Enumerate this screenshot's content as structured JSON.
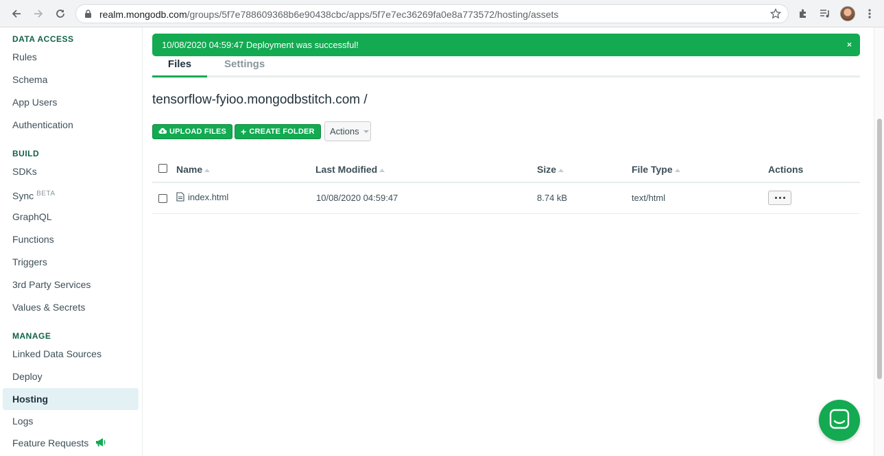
{
  "browser": {
    "url_host": "realm.mongodb.com",
    "url_path": "/groups/5f7e788609368b6e90438cbc/apps/5f7e7ec36269fa0e8a773572/hosting/assets"
  },
  "sidebar": {
    "sections": [
      {
        "title": "DATA ACCESS",
        "items": [
          "Rules",
          "Schema",
          "App Users",
          "Authentication"
        ]
      },
      {
        "title": "BUILD",
        "items": [
          "SDKs",
          "Sync",
          "GraphQL",
          "Functions",
          "Triggers",
          "3rd Party Services",
          "Values & Secrets"
        ]
      },
      {
        "title": "MANAGE",
        "items": [
          "Linked Data Sources",
          "Deploy",
          "Hosting",
          "Logs",
          "Feature Requests"
        ]
      }
    ],
    "sync_badge": "BETA",
    "active_item": "Hosting"
  },
  "alert": {
    "message": "10/08/2020 04:59:47 Deployment was successful!",
    "close": "×"
  },
  "tabs": [
    {
      "label": "Files",
      "active": true
    },
    {
      "label": "Settings",
      "active": false
    }
  ],
  "path_heading": "tensorflow-fyioo.mongodbstitch.com /",
  "toolbar": {
    "upload_label": "UPLOAD FILES",
    "create_folder_label": "CREATE FOLDER",
    "actions_label": "Actions"
  },
  "table": {
    "headers": [
      "Name",
      "Last Modified",
      "Size",
      "File Type",
      "Actions"
    ],
    "rows": [
      {
        "name": "index.html",
        "modified": "10/08/2020 04:59:47",
        "size": "8.74 kB",
        "type": "text/html"
      }
    ]
  },
  "colors": {
    "accent_green": "#13aa52",
    "active_bg": "#e3f1f5",
    "section_title": "#116149"
  }
}
